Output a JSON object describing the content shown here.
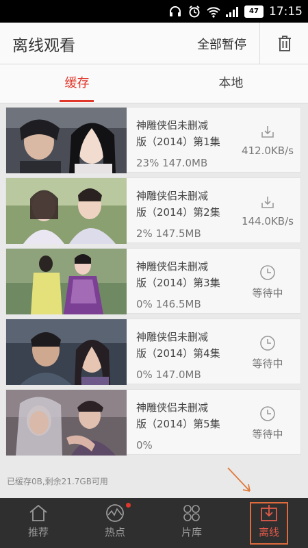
{
  "status_bar": {
    "time": "17:15",
    "battery": "47"
  },
  "header": {
    "title": "离线观看",
    "pause_all": "全部暂停"
  },
  "tabs": [
    {
      "label": "缓存",
      "active": true
    },
    {
      "label": "本地",
      "active": false
    }
  ],
  "items": [
    {
      "title_line1": "神雕侠侣未删减",
      "title_line2": "版（2014）第1集",
      "progress": "23% 147.0MB",
      "status": "412.0KB/s",
      "status_icon": "download-icon"
    },
    {
      "title_line1": "神雕侠侣未删减",
      "title_line2": "版（2014）第2集",
      "progress": "2% 147.5MB",
      "status": "144.0KB/s",
      "status_icon": "download-icon"
    },
    {
      "title_line1": "神雕侠侣未删减",
      "title_line2": "版（2014）第3集",
      "progress": "0% 146.5MB",
      "status": "等待中",
      "status_icon": "clock-icon"
    },
    {
      "title_line1": "神雕侠侣未删减",
      "title_line2": "版（2014）第4集",
      "progress": "0% 147.0MB",
      "status": "等待中",
      "status_icon": "clock-icon"
    },
    {
      "title_line1": "神雕侠侣未删减",
      "title_line2": "版（2014）第5集",
      "progress": "0%",
      "status": "等待中",
      "status_icon": "clock-icon"
    }
  ],
  "storage_text": "已缓存0B,剩余21.7GB可用",
  "nav": [
    {
      "label": "推荐"
    },
    {
      "label": "热点"
    },
    {
      "label": "片库"
    },
    {
      "label": "离线"
    }
  ],
  "colors": {
    "accent": "#e0382b",
    "nav_bg": "#2f2f2f",
    "highlight_box": "#e06a3c"
  }
}
